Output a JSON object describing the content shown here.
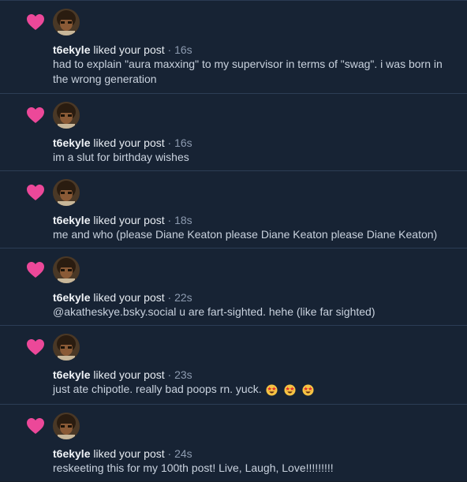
{
  "colors": {
    "background": "#172334",
    "divider": "#2c3d55",
    "heart": "#ec4899",
    "text": "#c9d2de",
    "muted": "#8d9bb0"
  },
  "icons": {
    "like": "heart-icon",
    "emoji": "star-struck-emoji"
  },
  "notifications": [
    {
      "user": "t6ekyle",
      "action": "liked your post",
      "separator": "·",
      "time": "16s",
      "text": "had to explain \"aura maxxing\" to my supervisor in terms of \"swag\". i was born in the wrong generation"
    },
    {
      "user": "t6ekyle",
      "action": "liked your post",
      "separator": "·",
      "time": "16s",
      "text": "im a slut for birthday wishes"
    },
    {
      "user": "t6ekyle",
      "action": "liked your post",
      "separator": "·",
      "time": "18s",
      "text": "me and who (please Diane Keaton please Diane Keaton please Diane Keaton)"
    },
    {
      "user": "t6ekyle",
      "action": "liked your post",
      "separator": "·",
      "time": "22s",
      "text": "@akatheskye.bsky.social u are fart-sighted. hehe (like far sighted)"
    },
    {
      "user": "t6ekyle",
      "action": "liked your post",
      "separator": "·",
      "time": "23s",
      "text": "just ate chipotle. really bad poops rn. yuck.",
      "emoji_count": 3
    },
    {
      "user": "t6ekyle",
      "action": "liked your post",
      "separator": "·",
      "time": "24s",
      "text": "reskeeting this for my 100th post! Live, Laugh, Love!!!!!!!!!"
    }
  ]
}
